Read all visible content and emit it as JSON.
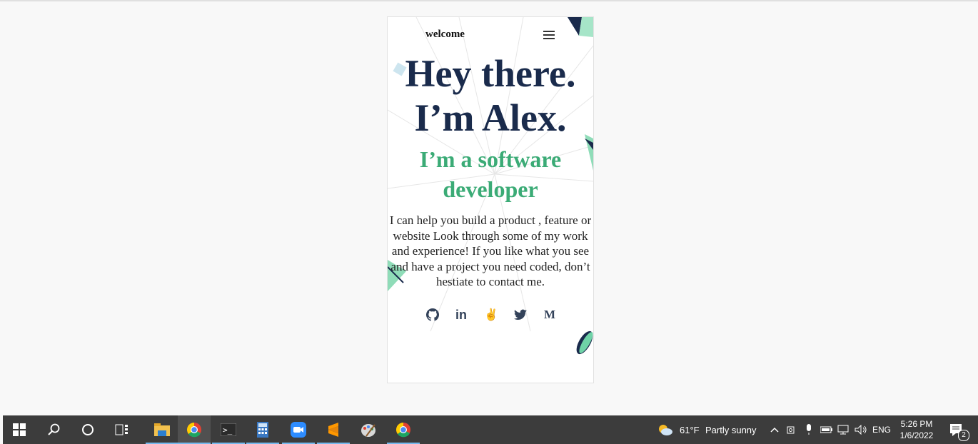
{
  "page": {
    "brand": "welcome",
    "hero_line1": "Hey there.",
    "hero_line2": "I’m Alex.",
    "subtitle_line1": "I’m a software",
    "subtitle_line2": "developer",
    "bio": "I can help you build a product , feature or website Look through some of my work and experience! If you like what you see and have a project you need coded, don’t hestiate to contact me.",
    "socials": [
      {
        "name": "github-icon"
      },
      {
        "name": "linkedin-icon",
        "label": "in"
      },
      {
        "name": "angellist-icon",
        "label": "✌"
      },
      {
        "name": "twitter-icon"
      },
      {
        "name": "medium-icon",
        "label": "M"
      }
    ],
    "colors": {
      "navy": "#1a2b4c",
      "green": "#3bab76",
      "accent_mint": "#6fd3a7"
    }
  },
  "taskbar": {
    "apps": [
      "start-icon",
      "search-icon",
      "cortana-icon",
      "task-view-icon",
      "file-explorer-icon",
      "chrome-icon",
      "terminal-icon",
      "calculator-icon",
      "zoom-icon",
      "sublime-icon",
      "paint-icon",
      "chrome-icon"
    ],
    "weather": {
      "temp": "61°F",
      "condition": "Partly sunny"
    },
    "language": "ENG",
    "time": "5:26 PM",
    "date": "1/6/2022",
    "notification_count": "2"
  }
}
